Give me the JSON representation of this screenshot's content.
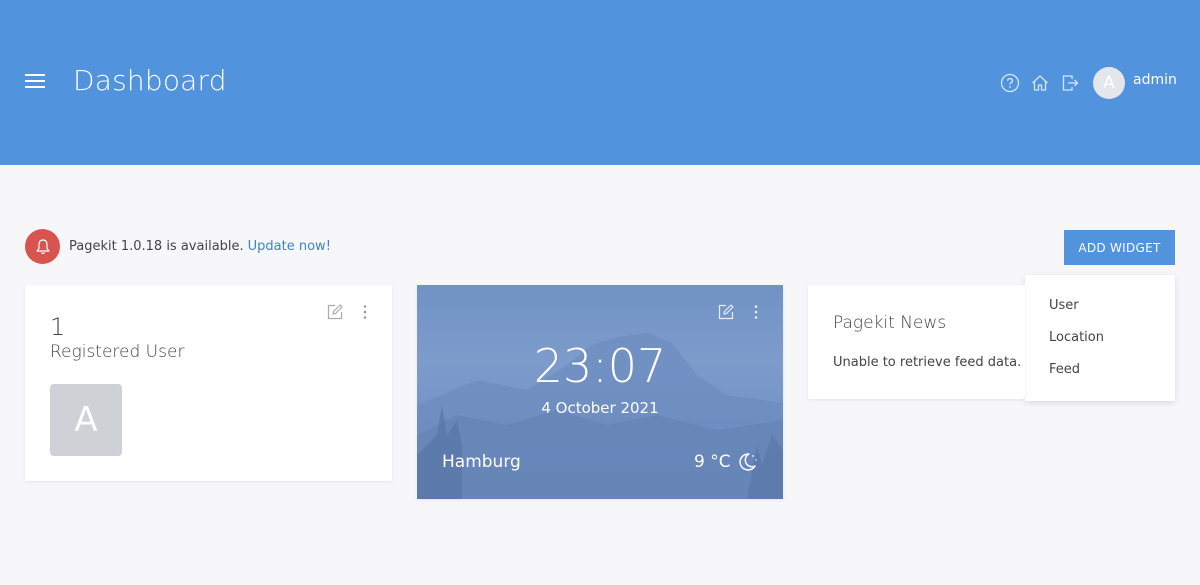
{
  "header": {
    "title": "Dashboard",
    "user": {
      "initial": "A",
      "name": "admin"
    },
    "icons": [
      "help-icon",
      "home-icon",
      "logout-icon"
    ],
    "background_color": "#5193dc"
  },
  "notice": {
    "text": "Pagekit 1.0.18 is available.",
    "link": "Update now!",
    "icon": "bell-icon",
    "icon_color": "#d9534f"
  },
  "add_widget": {
    "label": "ADD WIDGET",
    "menu": [
      "User",
      "Location",
      "Feed"
    ]
  },
  "widgets": {
    "users": {
      "count": "1",
      "label": "Registered User",
      "avatar_initial": "A"
    },
    "clock": {
      "time": "23:07",
      "date": "4 October 2021",
      "city": "Hamburg",
      "temperature": "9 °C",
      "weather_icon": "moon-icon"
    },
    "news": {
      "title": "Pagekit News",
      "message": "Unable to retrieve feed data."
    }
  }
}
